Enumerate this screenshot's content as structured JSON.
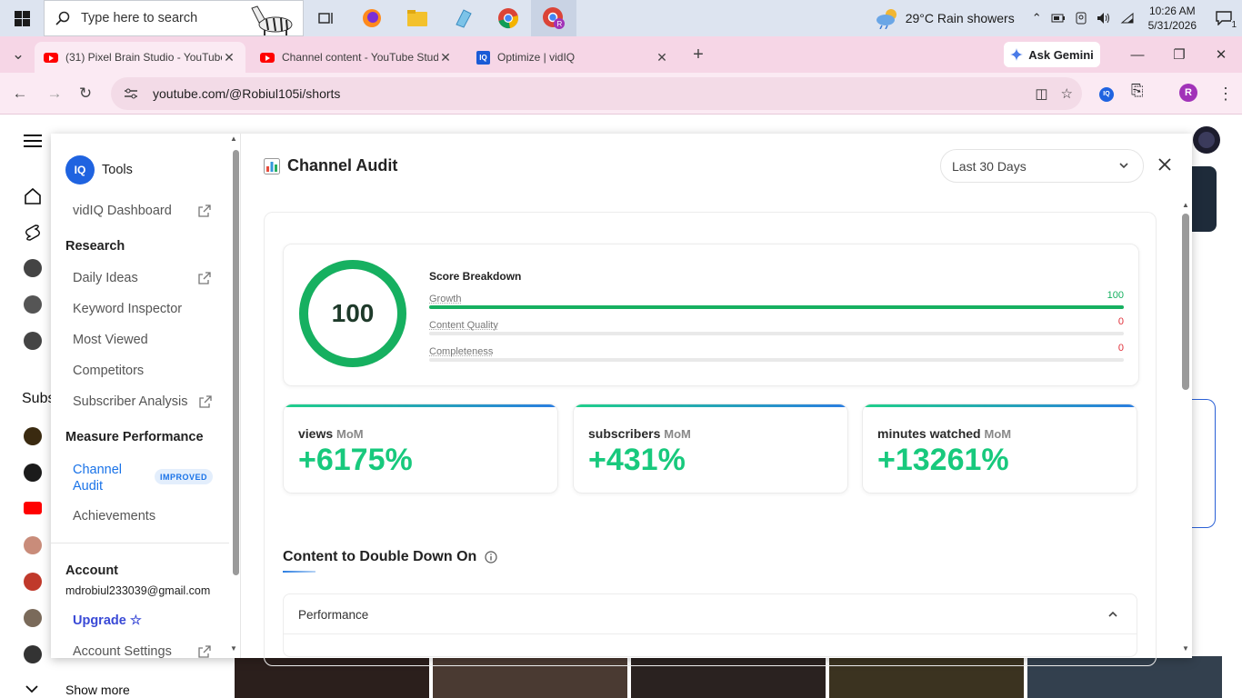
{
  "taskbar": {
    "search_placeholder": "Type here to search",
    "weather": "29°C  Rain showers",
    "time": "10:26 AM",
    "date": "5/31/2026",
    "notification_count": "1"
  },
  "browser": {
    "tabs": [
      {
        "title": "(31) Pixel Brain Studio - YouTube",
        "active": true
      },
      {
        "title": "Channel content - YouTube Studio",
        "active": false
      },
      {
        "title": "Optimize | vidIQ",
        "active": false
      }
    ],
    "gemini_label": "Ask Gemini",
    "url": "youtube.com/@Robiul105i/shorts",
    "profile_initial": "R"
  },
  "youtube": {
    "show_more": "Show more",
    "subscriptions_partial": "Subs"
  },
  "vidiq": {
    "sidebar": {
      "tools_label": "Tools",
      "dashboard": "vidIQ Dashboard",
      "research_heading": "Research",
      "research_items": [
        "Daily Ideas",
        "Keyword Inspector",
        "Most Viewed",
        "Competitors",
        "Subscriber Analysis"
      ],
      "measure_heading": "Measure Performance",
      "active_item": "Channel Audit",
      "active_badge": "IMPROVED",
      "achievements": "Achievements",
      "account_heading": "Account",
      "email": "mdrobiul233039@gmail.com",
      "upgrade": "Upgrade",
      "account_settings": "Account Settings"
    },
    "main": {
      "title": "Channel Audit",
      "date_range": "Last 30 Days",
      "score": "100",
      "score_fraction": 1.0,
      "breakdown_title": "Score Breakdown",
      "breakdown": [
        {
          "label": "Growth",
          "value": "100",
          "fraction": 1.0,
          "color": "#16b060"
        },
        {
          "label": "Content Quality",
          "value": "0",
          "fraction": 0,
          "color": "#e0303a"
        },
        {
          "label": "Completeness",
          "value": "0",
          "fraction": 0,
          "color": "#e0303a"
        }
      ],
      "metrics": [
        {
          "label": "views",
          "sub": "MoM",
          "value": "+6175%"
        },
        {
          "label": "subscribers",
          "sub": "MoM",
          "value": "+431%"
        },
        {
          "label": "minutes watched",
          "sub": "MoM",
          "value": "+13261%"
        }
      ],
      "section_title": "Content to Double Down On",
      "performance_label": "Performance"
    },
    "colors": {
      "accent_green": "#18c97d",
      "brand_blue": "#1f63e0",
      "link_blue": "#1a73e8"
    }
  }
}
